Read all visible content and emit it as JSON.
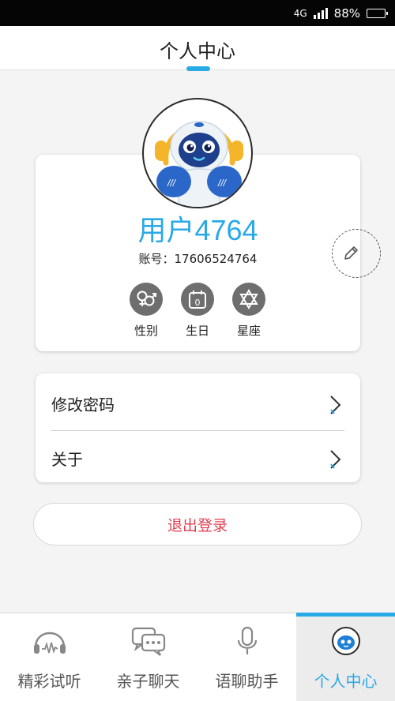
{
  "status_bar": {
    "network": "4G",
    "battery_percent": "88%",
    "battery_level": 0.88
  },
  "header": {
    "title": "个人中心"
  },
  "profile": {
    "username": "用户4764",
    "account": "账号：17606524764",
    "info_items": [
      {
        "label": "性别",
        "icon": "gender-icon"
      },
      {
        "label": "生日",
        "icon": "calendar-icon"
      },
      {
        "label": "星座",
        "icon": "star-of-david-icon"
      }
    ],
    "calendar_value": "0"
  },
  "menu": {
    "items": [
      {
        "label": "修改密码"
      },
      {
        "label": "关于"
      }
    ]
  },
  "logout": {
    "label": "退出登录"
  },
  "bottom_nav": {
    "items": [
      {
        "label": "精彩试听",
        "icon": "headphones-icon"
      },
      {
        "label": "亲子聊天",
        "icon": "chat-bubbles-icon"
      },
      {
        "label": "语聊助手",
        "icon": "microphone-icon"
      },
      {
        "label": "个人中心",
        "icon": "robot-icon",
        "active": true
      }
    ]
  },
  "colors": {
    "accent": "#29a9e6",
    "logout_text": "#e04050",
    "icon_gray": "#6e6e6e"
  }
}
